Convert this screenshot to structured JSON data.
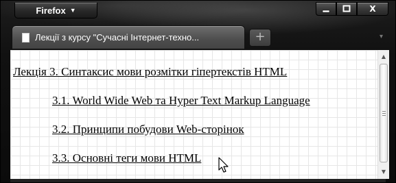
{
  "browser": {
    "menu_button_label": "Firefox",
    "menu_arrow": "▼",
    "window_controls": {
      "minimize_icon": "minimize-icon",
      "maximize_icon": "maximize-icon",
      "close_label": "X"
    }
  },
  "tabs": [
    {
      "title": "Лекції з курсу \"Сучасні Інтернет-техно...",
      "icon": "page-icon"
    }
  ],
  "new_tab_label": "+",
  "tab_list_arrow": "▾",
  "page": {
    "links": [
      {
        "text": "Лекція 3. Синтаксис мови розмітки гіпертекстів HTML"
      },
      {
        "text": "3.1. World Wide Web та Hyper Text Markup Language"
      },
      {
        "text": "3.2. Принципи побудови Web-сторінок"
      },
      {
        "text": "3.3. Основні теги мови HTML"
      }
    ]
  },
  "scrollbar": {
    "up_arrow": "▲",
    "down_arrow": "▼"
  },
  "colors": {
    "chrome": "#111111",
    "page_background": "#ffffff",
    "grid": "#e6e6e6",
    "link": "#000000"
  }
}
